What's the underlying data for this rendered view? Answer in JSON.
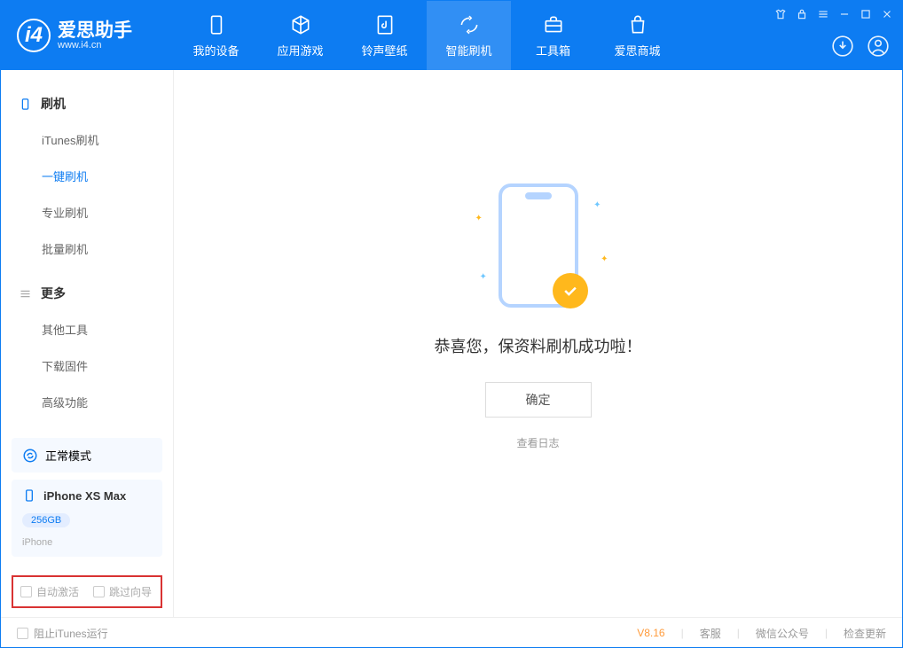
{
  "header": {
    "appName": "爱思助手",
    "url": "www.i4.cn",
    "tabs": [
      {
        "label": "我的设备"
      },
      {
        "label": "应用游戏"
      },
      {
        "label": "铃声壁纸"
      },
      {
        "label": "智能刷机"
      },
      {
        "label": "工具箱"
      },
      {
        "label": "爱思商城"
      }
    ]
  },
  "sidebar": {
    "group1": {
      "title": "刷机",
      "items": [
        "iTunes刷机",
        "一键刷机",
        "专业刷机",
        "批量刷机"
      ]
    },
    "group2": {
      "title": "更多",
      "items": [
        "其他工具",
        "下载固件",
        "高级功能"
      ]
    },
    "mode": "正常模式",
    "device": {
      "name": "iPhone XS Max",
      "storage": "256GB",
      "type": "iPhone"
    },
    "checks": {
      "auto": "自动激活",
      "skip": "跳过向导"
    }
  },
  "main": {
    "successMsg": "恭喜您，保资料刷机成功啦！",
    "okBtn": "确定",
    "logLink": "查看日志"
  },
  "footer": {
    "block": "阻止iTunes运行",
    "version": "V8.16",
    "links": [
      "客服",
      "微信公众号",
      "检查更新"
    ]
  }
}
